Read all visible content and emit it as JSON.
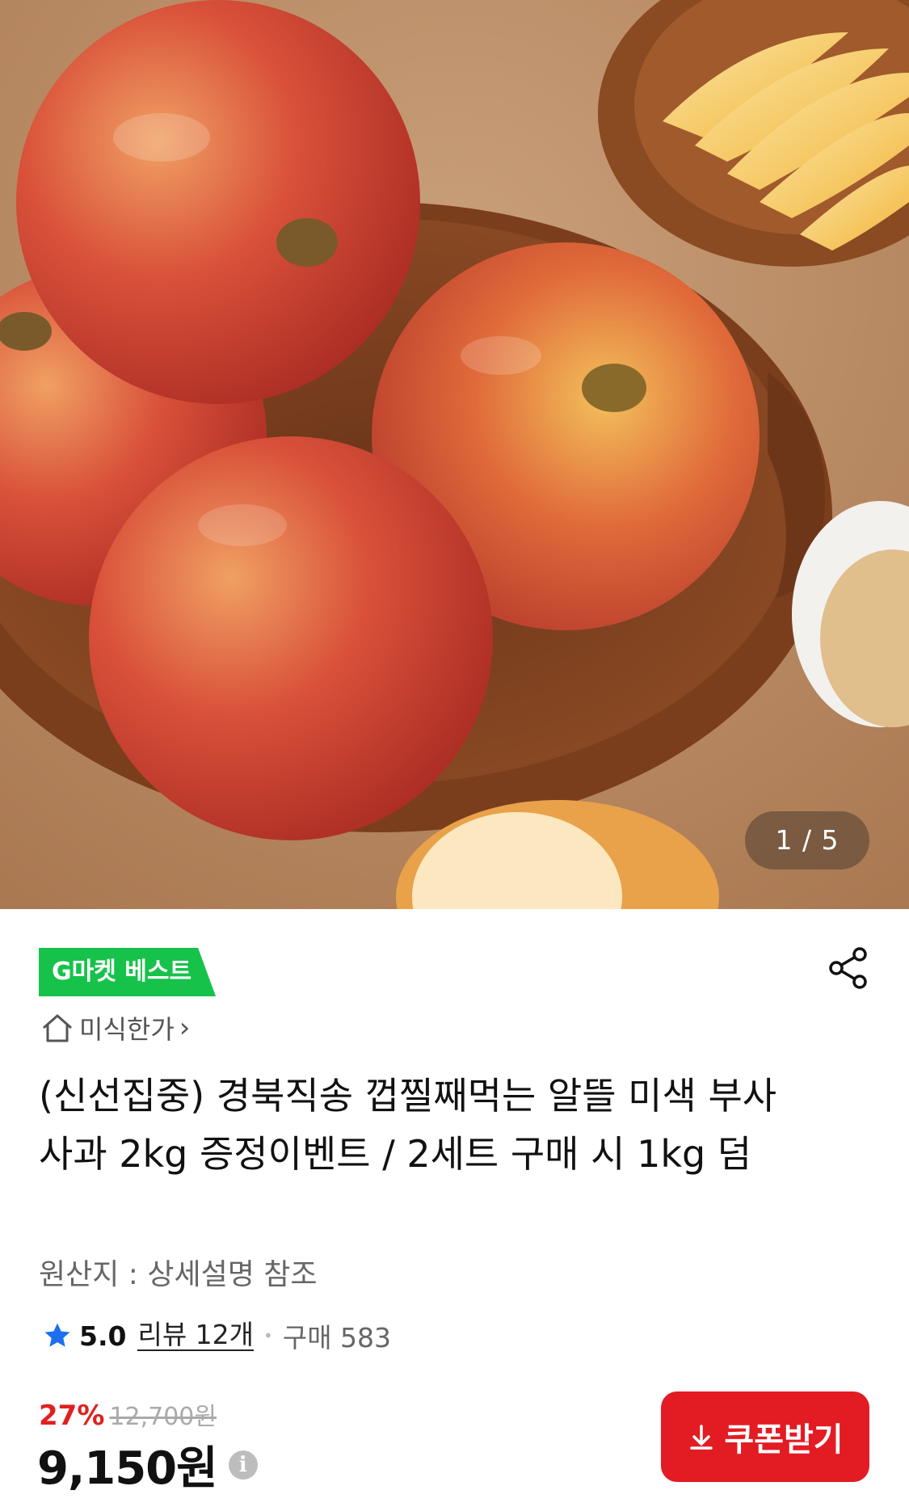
{
  "gallery": {
    "counter": "1 / 5"
  },
  "badge": {
    "label": "G마켓 베스트"
  },
  "store": {
    "name": "미식한가",
    "chevron": "›"
  },
  "product": {
    "title": "(신선집중) 경북직송 껍찔째먹는 알뜰 미색 부사 사과 2kg 증정이벤트 / 2세트 구매 시 1kg 덤",
    "origin": "원산지 : 상세설명 참조"
  },
  "rating": {
    "score": "5.0",
    "reviews": "리뷰 12개",
    "separator": "•",
    "sold": "구매 583"
  },
  "price": {
    "discount": "27%",
    "original": "12,700원",
    "final": "9,150원",
    "info": "i"
  },
  "coupon": {
    "label": "쿠폰받기"
  },
  "icons": {
    "share": "share-icon",
    "home": "home-icon",
    "star": "star-icon",
    "download": "download-icon",
    "info": "info-icon"
  },
  "colors": {
    "badge": "#17c24a",
    "discount": "#e02020",
    "coupon": "#e31b23",
    "star": "#1e6ff0"
  }
}
